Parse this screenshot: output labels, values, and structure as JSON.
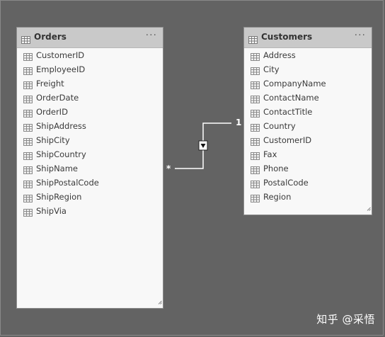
{
  "tables": [
    {
      "name": "Orders",
      "more_label": "···",
      "fields": [
        "CustomerID",
        "EmployeeID",
        "Freight",
        "OrderDate",
        "OrderID",
        "ShipAddress",
        "ShipCity",
        "ShipCountry",
        "ShipName",
        "ShipPostalCode",
        "ShipRegion",
        "ShipVia"
      ]
    },
    {
      "name": "Customers",
      "more_label": "···",
      "fields": [
        "Address",
        "City",
        "CompanyName",
        "ContactName",
        "ContactTitle",
        "Country",
        "CustomerID",
        "Fax",
        "Phone",
        "PostalCode",
        "Region"
      ]
    }
  ],
  "relationship": {
    "many_label": "*",
    "one_label": "1",
    "direction_icon": "filter-direction-down-icon"
  },
  "watermark": "知乎 @采悟",
  "colors": {
    "canvas": "#636363",
    "card_header": "#c9c9c9",
    "card_body": "#f8f8f8",
    "relationship_line": "#ffffff"
  }
}
